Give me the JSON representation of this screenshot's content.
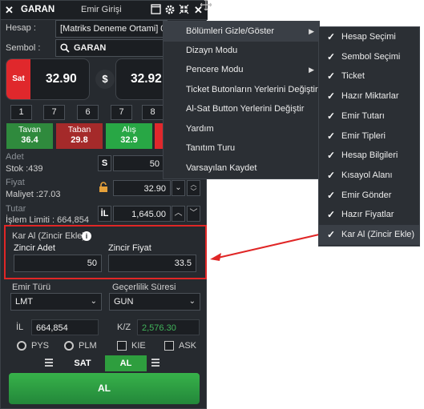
{
  "window": {
    "symbol": "GARAN",
    "title": "Emir Girişi"
  },
  "account": {
    "label": "Hesap :",
    "value": "[Matriks Deneme Ortami] 0-"
  },
  "symbol_row": {
    "label": "Sembol :",
    "value": "GARAN"
  },
  "prices": {
    "sell_label": "Sat",
    "sell_price": "32.90",
    "buy_price": "32.92"
  },
  "quantities": [
    "1",
    "7",
    "6",
    "7",
    "8"
  ],
  "limits": {
    "tavan_label": "Tavan",
    "tavan_value": "36.4",
    "taban_label": "Taban",
    "taban_value": "29.8",
    "alis_label": "Alış",
    "alis_value": "32.9"
  },
  "order": {
    "adet_label": "Adet",
    "stok_label": "Stok :439",
    "s_label": "S",
    "adet_value": "50",
    "fiyat_label": "Fiyat",
    "maliyet_label": "Maliyet :27.03",
    "fiyat_value": "32.90",
    "tutar_label": "Tutar",
    "islem_limiti_label": "İşlem Limiti : 664,854",
    "il_label": "İL",
    "tutar_value": "1,645.00"
  },
  "kar_al": {
    "title": "Kar Al (Zincir Ekle)",
    "adet_label": "Zincir Adet",
    "adet_value": "50",
    "fiyat_label": "Zincir Fiyat",
    "fiyat_value": "33.5"
  },
  "emir_turu": {
    "label": "Emir Türü",
    "value": "LMT"
  },
  "gecerlilik": {
    "label": "Geçerlilik Süresi",
    "value": "GUN"
  },
  "bottom": {
    "il_label": "İL",
    "il_value": "664,854",
    "kz_label": "K/Z",
    "kz_value": "2,576.30",
    "pys_label": "PYS",
    "plm_label": "PLM",
    "kie_label": "KIE",
    "ask_label": "ASK",
    "sat_tab": "SAT",
    "al_tab": "AL",
    "al_button": "AL"
  },
  "menu": {
    "items": [
      {
        "label": "Bölümleri Gizle/Göster",
        "submenu": true
      },
      {
        "label": "Dizayn Modu",
        "submenu": false
      },
      {
        "label": "Pencere Modu",
        "submenu": true
      },
      {
        "label": "Ticket Butonların Yerlerini Değiştir",
        "submenu": false
      },
      {
        "label": "Al-Sat Button Yerlerini Değiştir",
        "submenu": false
      },
      {
        "label": "Yardım",
        "submenu": false
      },
      {
        "label": "Tanıtım Turu",
        "submenu": false
      },
      {
        "label": "Varsayılan Kaydet",
        "submenu": false
      }
    ],
    "submenu_items": [
      "Hesap Seçimi",
      "Sembol Seçimi",
      "Ticket",
      "Hazır Miktarlar",
      "Emir Tutarı",
      "Emir Tipleri",
      "Hesap Bilgileri",
      "Kısayol Alanı",
      "Emir Gönder",
      "Hazır Fiyatlar",
      "Kar Al (Zincir Ekle)"
    ]
  },
  "colors": {
    "sell_red": "#e0282c",
    "tavan_green": "#2f8a3d",
    "taban_red": "#a52a2a",
    "alis_green": "#28a745",
    "al_button_green": "#2e9e3e",
    "annotation_red": "#e02626",
    "kz_green": "#41b45a"
  }
}
